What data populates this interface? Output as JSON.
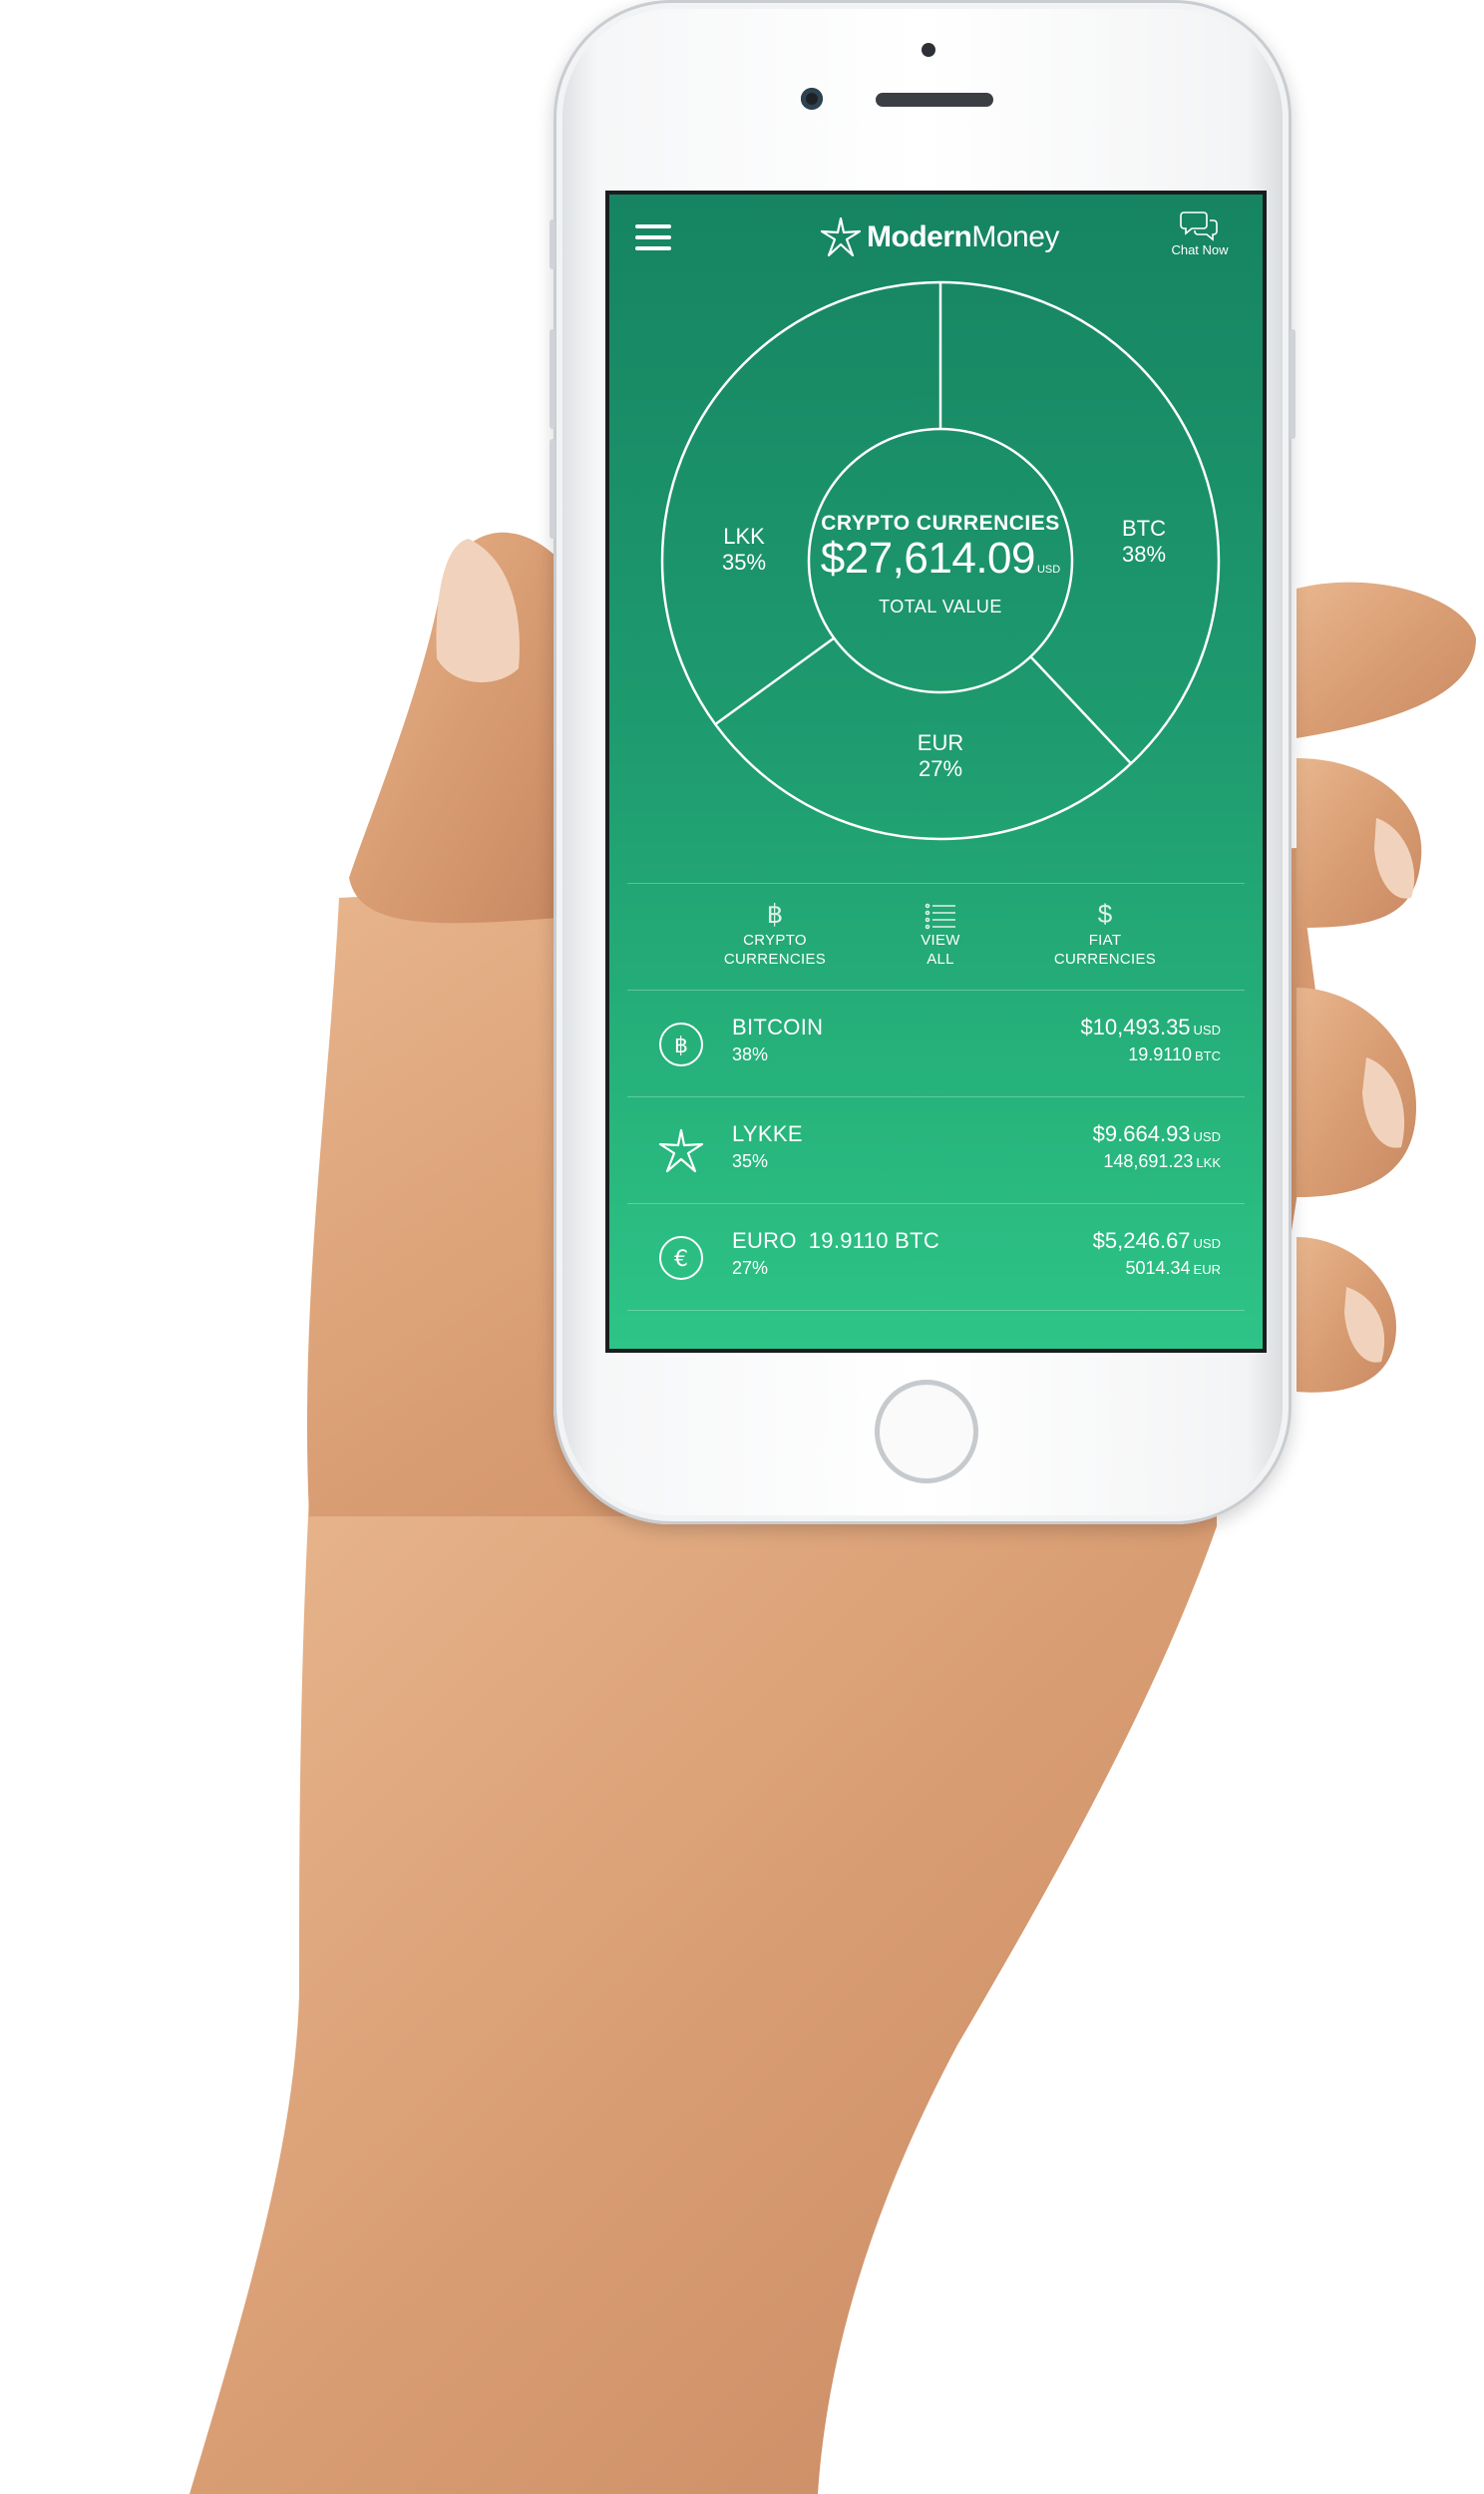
{
  "app": {
    "brand_bold": "Modern",
    "brand_regular": "Money",
    "chat_label": "Chat Now",
    "accent": "#1e9a6f"
  },
  "summary": {
    "title": "CRYPTO CURRENCIES",
    "total": "$27,614.09",
    "total_currency": "USD",
    "subtitle": "TOTAL VALUE",
    "segments": [
      {
        "code": "BTC",
        "percent": "38%"
      },
      {
        "code": "EUR",
        "percent": "27%"
      },
      {
        "code": "LKK",
        "percent": "35%"
      }
    ]
  },
  "tabs": [
    {
      "icon": "bitcoin-icon",
      "line1": "CRYPTO",
      "line2": "CURRENCIES"
    },
    {
      "icon": "list-icon",
      "line1": "VIEW",
      "line2": "ALL"
    },
    {
      "icon": "dollar-icon",
      "line1": "FIAT",
      "line2": "CURRENCIES"
    }
  ],
  "assets": [
    {
      "icon": "bitcoin-circle-icon",
      "name": "BITCOIN",
      "extra": "",
      "percent": "38%",
      "usd_value": "$10,493.35",
      "usd_unit": "USD",
      "native_value": "19.9110",
      "native_unit": "BTC"
    },
    {
      "icon": "lykke-star-icon",
      "name": "LYKKE",
      "extra": "",
      "percent": "35%",
      "usd_value": "$9.664.93",
      "usd_unit": "USD",
      "native_value": "148,691.23",
      "native_unit": "LKK"
    },
    {
      "icon": "euro-circle-icon",
      "name": "EURO",
      "extra": "19.9110 BTC",
      "percent": "27%",
      "usd_value": "$5,246.67",
      "usd_unit": "USD",
      "native_value": "5014.34",
      "native_unit": "EUR"
    }
  ]
}
